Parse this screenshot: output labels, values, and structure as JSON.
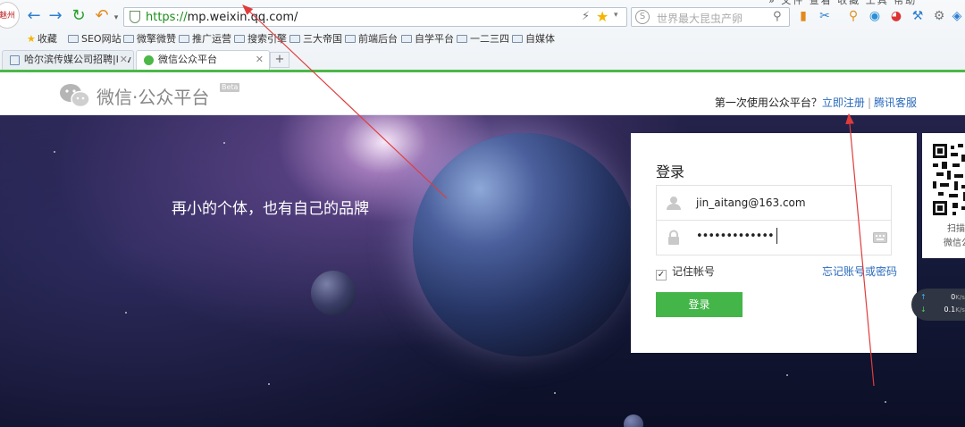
{
  "browser": {
    "avatar_text": "魅州",
    "url_protocol": "https://",
    "url_rest": "mp.weixin.qq.com/",
    "search_placeholder": "世界最大昆虫产卵",
    "menu_peek": "» 文件 查看 收藏 工具 帮助",
    "bookmarks": [
      "收藏",
      "SEO网站",
      "微擎微赞",
      "推广运营",
      "搜索引擎",
      "三大帝国",
      "前端后台",
      "自学平台",
      "一二三四",
      "自媒体"
    ],
    "tabs": [
      {
        "label": "哈尔滨传媒公司招聘|ktv",
        "active": false
      },
      {
        "label": "微信公众平台",
        "active": true
      }
    ],
    "new_tab": "+"
  },
  "header": {
    "title": "微信·公众平台",
    "beta": "Beta",
    "prompt": "第一次使用公众平台？",
    "register_link": "立即注册",
    "separator": "|",
    "service_link": "腾讯客服"
  },
  "banner": {
    "slogan": "再小的个体，也有自己的品牌"
  },
  "login": {
    "title": "登录",
    "account": "jin_aitang@163.com",
    "password_mask": "•••••••••••••",
    "remember_label": "记住帐号",
    "remember_checked": true,
    "forgot_link": "忘记账号或密码",
    "button_label": "登录",
    "button_color": "#44b549"
  },
  "qr": {
    "caption_line1": "扫描",
    "caption_line2": "微信公"
  },
  "network": {
    "up_value": "0",
    "up_unit": "K/s",
    "down_value": "0.1",
    "down_unit": "K/s"
  },
  "colors": {
    "accent_green": "#4cb848",
    "link_blue": "#2b6bbd",
    "annotation_red": "#e03c3c"
  }
}
